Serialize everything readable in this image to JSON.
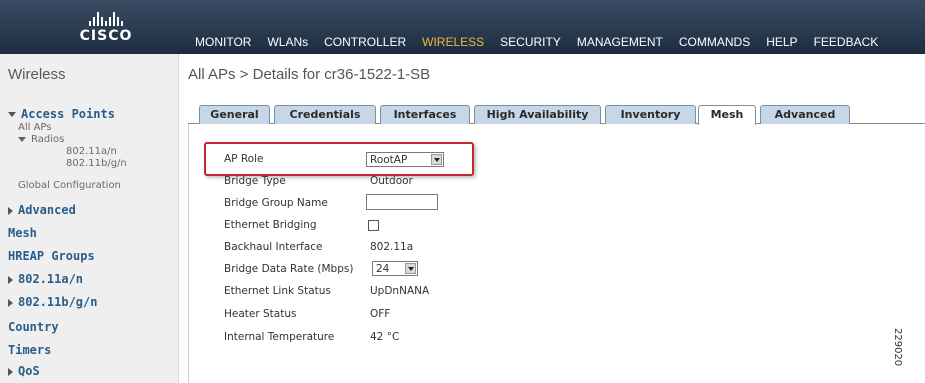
{
  "brand": {
    "name": "CISCO"
  },
  "top_menu": [
    {
      "label": "MONITOR",
      "active": false
    },
    {
      "label": "WLANs",
      "active": false
    },
    {
      "label": "CONTROLLER",
      "active": false
    },
    {
      "label": "WIRELESS",
      "active": true
    },
    {
      "label": "SECURITY",
      "active": false
    },
    {
      "label": "MANAGEMENT",
      "active": false
    },
    {
      "label": "COMMANDS",
      "active": false
    },
    {
      "label": "HELP",
      "active": false
    },
    {
      "label": "FEEDBACK",
      "active": false
    }
  ],
  "sidebar": {
    "title": "Wireless",
    "access_points": "Access Points",
    "all_aps": "All APs",
    "radios": "Radios",
    "radio_a": "802.11a/n",
    "radio_b": "802.11b/g/n",
    "global_config": "Global Configuration",
    "advanced": "Advanced",
    "mesh": "Mesh",
    "hreap": "HREAP Groups",
    "n_a": "802.11a/n",
    "n_bg": "802.11b/g/n",
    "country": "Country",
    "timers": "Timers",
    "qos": "QoS"
  },
  "breadcrumb": "All APs > Details for cr36-1522-1-SB",
  "tabs": [
    {
      "label": "General"
    },
    {
      "label": "Credentials"
    },
    {
      "label": "Interfaces"
    },
    {
      "label": "High Availability"
    },
    {
      "label": "Inventory"
    },
    {
      "label": "Mesh",
      "active": true
    },
    {
      "label": "Advanced"
    }
  ],
  "mesh": {
    "ap_role_label": "AP Role",
    "ap_role_value": "RootAP",
    "bridge_type_label": "Bridge Type",
    "bridge_type_value": "Outdoor",
    "bridge_group_label": "Bridge Group Name",
    "bridge_group_value": "",
    "eth_bridging_label": "Ethernet Bridging",
    "eth_bridging_checked": false,
    "backhaul_label": "Backhaul Interface",
    "backhaul_value": "802.11a",
    "data_rate_label": "Bridge Data Rate (Mbps)",
    "data_rate_value": "24",
    "eth_link_label": "Ethernet Link Status",
    "eth_link_value": "UpDnNANA",
    "heater_label": "Heater Status",
    "heater_value": "OFF",
    "temp_label": "Internal Temperature",
    "temp_value": "42 °C"
  },
  "figure_id": "229020",
  "colors": {
    "highlight": "#c0282e",
    "active_menu": "#f0b840",
    "sidebar_link": "#2b5d8a"
  }
}
